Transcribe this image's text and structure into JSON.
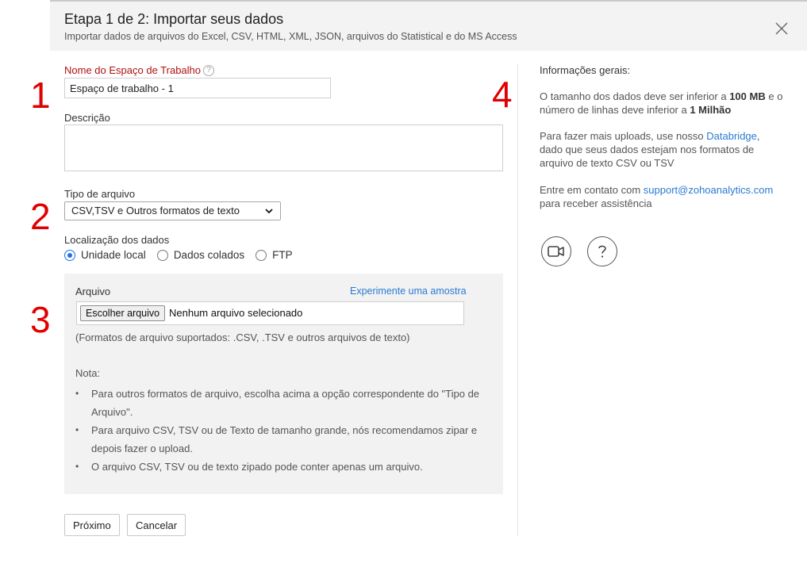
{
  "header": {
    "title": "Etapa 1 de 2: Importar seus dados",
    "subtitle": "Importar dados de arquivos do Excel, CSV, HTML, XML, JSON, arquivos do Statistical e do MS Access"
  },
  "steps": [
    "1",
    "2",
    "3",
    "4"
  ],
  "workspace": {
    "label": "Nome do Espaço de Trabalho",
    "help": "?",
    "value": "Espaço de trabalho - 1"
  },
  "description": {
    "label": "Descrição",
    "value": ""
  },
  "file_type": {
    "label": "Tipo de arquivo",
    "selected": "CSV,TSV e Outros formatos de texto"
  },
  "location": {
    "label": "Localização dos dados",
    "options": [
      {
        "label": "Unidade local",
        "selected": true
      },
      {
        "label": "Dados colados",
        "selected": false
      },
      {
        "label": "FTP",
        "selected": false
      }
    ]
  },
  "file_panel": {
    "label": "Arquivo",
    "sample_link": "Experimente uma amostra",
    "choose_button": "Escolher arquivo",
    "no_file": "Nenhum arquivo selecionado",
    "formats": "(Formatos de arquivo suportados: .CSV, .TSV e outros arquivos de texto)",
    "note_label": "Nota:",
    "notes": [
      "Para outros formatos de arquivo, escolha acima a opção correspondente do \"Tipo de Arquivo\".",
      "Para arquivo CSV, TSV ou de Texto de tamanho grande, nós recomendamos zipar e depois fazer o upload.",
      "O arquivo CSV, TSV ou de texto zipado pode conter apenas um arquivo."
    ]
  },
  "buttons": {
    "next": "Próximo",
    "cancel": "Cancelar"
  },
  "info": {
    "title": "Informações gerais:",
    "p1_a": "O tamanho dos dados deve ser inferior a ",
    "p1_b": "100 MB",
    "p1_c": " e o número de linhas deve inferior a ",
    "p1_d": "1 Milhão",
    "p2_a": "Para fazer mais uploads, use nosso ",
    "p2_link": "Databridge",
    "p2_b": ", dado que seus dados estejam nos formatos de arquivo de texto CSV ou TSV",
    "p3_a": "Entre em contato com ",
    "p3_link": "support@zohoanalytics.com",
    "p3_b": " para receber assistência"
  },
  "icons": {
    "video": "video-icon",
    "help": "help-icon",
    "close": "close-icon"
  },
  "colors": {
    "accent": "#2a7ad2",
    "step": "#e00000",
    "required": "#b01010"
  }
}
